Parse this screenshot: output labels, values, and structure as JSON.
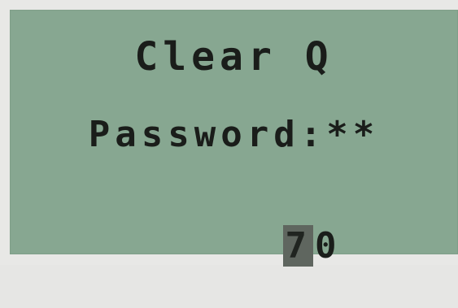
{
  "screen": {
    "title": "Clear Q",
    "prompt": "Password:**",
    "entry": {
      "active_digit": "7",
      "next_digit": "0"
    }
  },
  "colors": {
    "lcd_background": "#87a791",
    "text": "#1a1d1a",
    "cursor_background": "#5f665f"
  }
}
